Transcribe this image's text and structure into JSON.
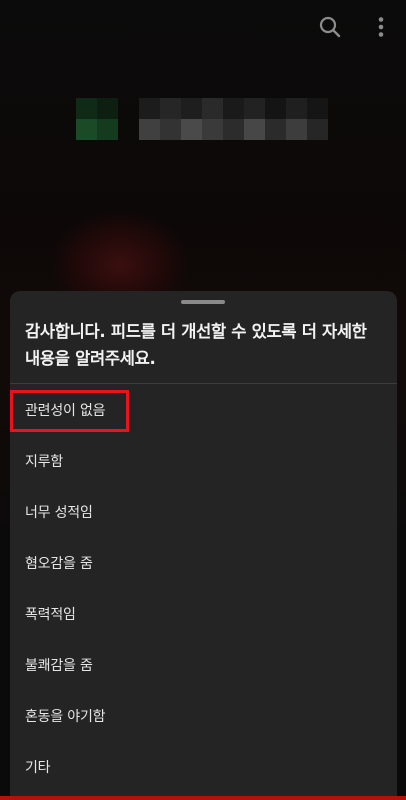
{
  "topbar": {
    "search_icon": "search-icon",
    "more_icon": "more-vertical-icon"
  },
  "sheet": {
    "title": "감사합니다. 피드를 더 개선할 수 있도록 더 자세한 내용을 알려주세요.",
    "options": [
      {
        "label": "관련성이 없음",
        "highlighted": true
      },
      {
        "label": "지루함"
      },
      {
        "label": "너무 성적임"
      },
      {
        "label": "혐오감을 줌"
      },
      {
        "label": "폭력적임"
      },
      {
        "label": "불쾌감을 줌"
      },
      {
        "label": "혼동을 야기함"
      },
      {
        "label": "기타"
      }
    ]
  },
  "colors": {
    "sheet_background": "#242424",
    "highlight_border": "#e8141c",
    "text": "#e6e6e6"
  }
}
